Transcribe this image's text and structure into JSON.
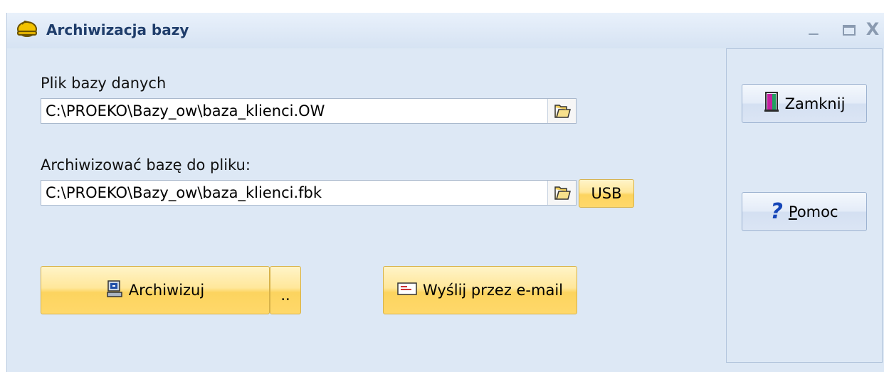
{
  "window": {
    "title": "Archiwizacja bazy",
    "controls": {
      "minimize": "_",
      "close": "X"
    }
  },
  "source": {
    "label": "Plik bazy danych",
    "path": "C:\\PROEKO\\Bazy_ow\\baza_klienci.OW"
  },
  "target": {
    "label": "Archiwizować bazę do pliku:",
    "path": "C:\\PROEKO\\Bazy_ow\\baza_klienci.fbk",
    "usb_label": "USB"
  },
  "actions": {
    "archive_label": "Archiwizuj",
    "more_label": "..",
    "email_label": "Wyślij przez e-mail"
  },
  "side": {
    "close_label": "Zamknij",
    "help_label": "Pomoc"
  },
  "colors": {
    "window_bg": "#dde8f5",
    "title_text": "#1f3d6b",
    "yellow_button": "#ffe07a",
    "blue_button": "#dbe5f4"
  },
  "icons": [
    "app-helmet-icon",
    "folder-open-icon",
    "archive-computer-icon",
    "envelope-icon",
    "exit-door-icon",
    "question-icon"
  ]
}
